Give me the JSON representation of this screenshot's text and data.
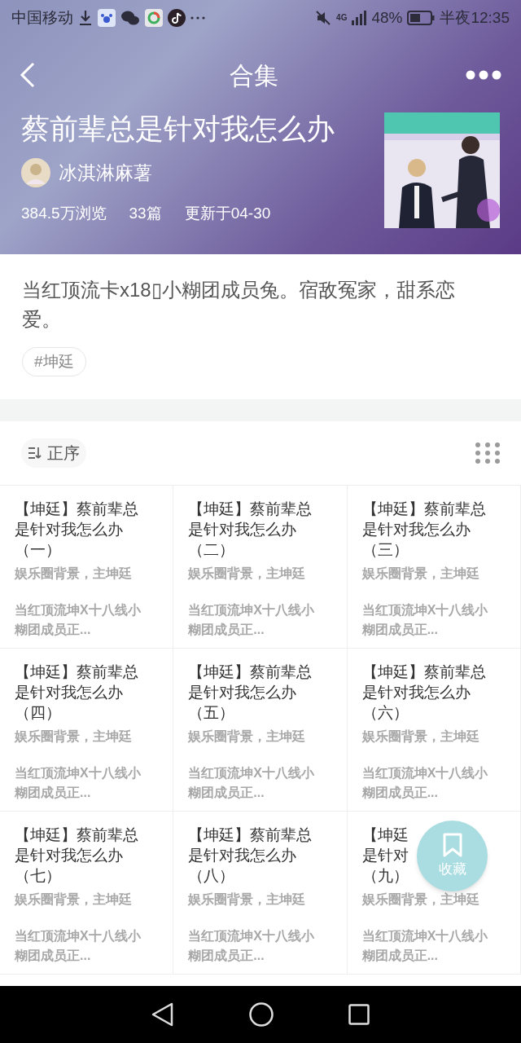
{
  "status_bar": {
    "carrier": "中国移动",
    "network": "4G",
    "battery": "48%",
    "time": "半夜12:35"
  },
  "nav": {
    "title": "合集"
  },
  "collection": {
    "title": "蔡前辈总是针对我怎么办",
    "author": "冰淇淋麻薯",
    "views": "384.5万浏览",
    "count": "33篇",
    "updated": "更新于04-30",
    "description": "当红顶流卡x18▯小糊团成员兔。宿敌冤家，甜系恋爱。",
    "tags": [
      "#坤廷"
    ]
  },
  "toolbar": {
    "sort_label": "正序"
  },
  "chapters": [
    {
      "title_lines": [
        "【坤廷】蔡前辈总",
        "是针对我怎么办",
        "（一）"
      ],
      "subtitle": "娱乐圈背景，主坤廷",
      "excerpt_lines": [
        "当红顶流坤X十八线小",
        "糊团成员正..."
      ]
    },
    {
      "title_lines": [
        "【坤廷】蔡前辈总",
        "是针对我怎么办",
        "（二）"
      ],
      "subtitle": "娱乐圈背景，主坤廷",
      "excerpt_lines": [
        "当红顶流坤X十八线小",
        "糊团成员正..."
      ]
    },
    {
      "title_lines": [
        "【坤廷】蔡前辈总",
        "是针对我怎么办",
        "（三）"
      ],
      "subtitle": "娱乐圈背景，主坤廷",
      "excerpt_lines": [
        "当红顶流坤X十八线小",
        "糊团成员正..."
      ]
    },
    {
      "title_lines": [
        "【坤廷】蔡前辈总",
        "是针对我怎么办",
        "（四）"
      ],
      "subtitle": "娱乐圈背景，主坤廷",
      "excerpt_lines": [
        "当红顶流坤X十八线小",
        "糊团成员正..."
      ]
    },
    {
      "title_lines": [
        "【坤廷】蔡前辈总",
        "是针对我怎么办",
        "（五）"
      ],
      "subtitle": "娱乐圈背景，主坤廷",
      "excerpt_lines": [
        "当红顶流坤X十八线小",
        "糊团成员正..."
      ]
    },
    {
      "title_lines": [
        "【坤廷】蔡前辈总",
        "是针对我怎么办",
        "（六）"
      ],
      "subtitle": "娱乐圈背景，主坤廷",
      "excerpt_lines": [
        "当红顶流坤X十八线小",
        "糊团成员正..."
      ]
    },
    {
      "title_lines": [
        "【坤廷】蔡前辈总",
        "是针对我怎么办",
        "（七）"
      ],
      "subtitle": "娱乐圈背景，主坤廷",
      "excerpt_lines": [
        "当红顶流坤X十八线小",
        "糊团成员正..."
      ]
    },
    {
      "title_lines": [
        "【坤廷】蔡前辈总",
        "是针对我怎么办",
        "（八）"
      ],
      "subtitle": "娱乐圈背景，主坤廷",
      "excerpt_lines": [
        "当红顶流坤X十八线小",
        "糊团成员正..."
      ]
    },
    {
      "title_lines": [
        "【坤廷",
        "是针对",
        "（九）"
      ],
      "subtitle": "娱乐圈背景，主坤廷",
      "excerpt_lines": [
        "当红顶流坤X十八线小",
        "糊团成员正..."
      ]
    }
  ],
  "fab": {
    "label": "收藏"
  }
}
